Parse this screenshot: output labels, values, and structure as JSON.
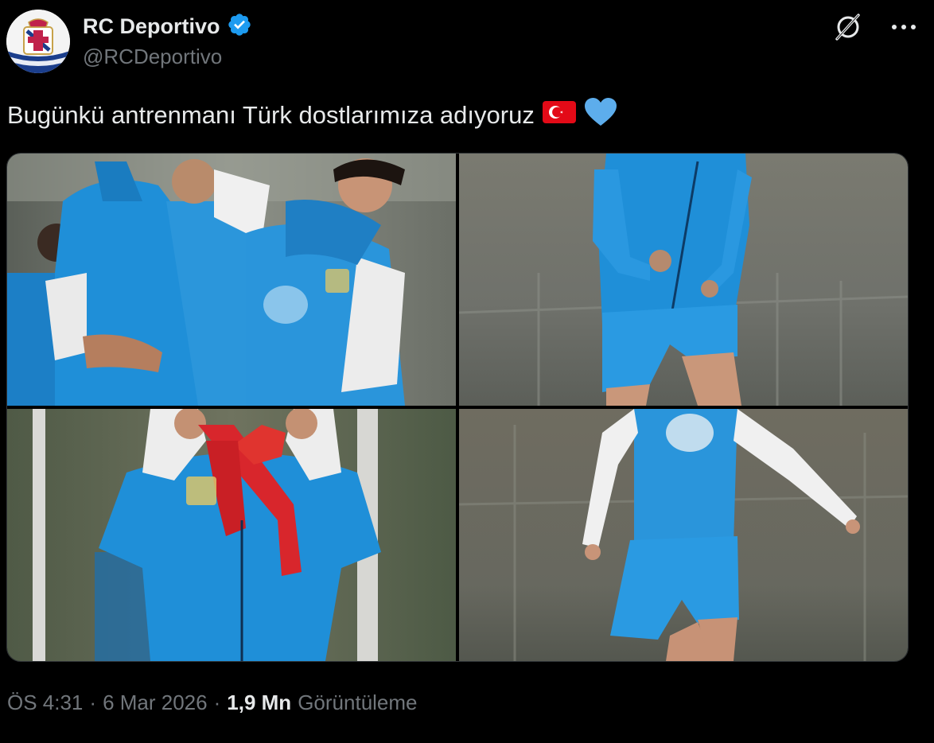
{
  "author": {
    "display_name": "RC Deportivo",
    "handle": "@RCDeportivo",
    "verified": true,
    "verified_badge_color": "#1d9bf0"
  },
  "tweet": {
    "text": "Bugünkü antrenmanı Türk dostlarımıza adıyoruz",
    "emojis": [
      "turkish-flag",
      "blue-heart"
    ]
  },
  "media": [
    {
      "name": "photo-players-hugging"
    },
    {
      "name": "photo-player-jogging"
    },
    {
      "name": "photo-player-with-red-band"
    },
    {
      "name": "photo-player-stretching"
    }
  ],
  "meta": {
    "time": "ÖS 4:31",
    "separator": "·",
    "date": "6 Mar 2026",
    "views_count": "1,9 Mn",
    "views_label": "Görüntüleme"
  },
  "icons": {
    "grok": "grok-icon",
    "more": "more-icon"
  },
  "colors": {
    "background": "#000000",
    "text_primary": "#e7e9ea",
    "text_secondary": "#71767b",
    "kit_blue": "#1f8fd8"
  }
}
